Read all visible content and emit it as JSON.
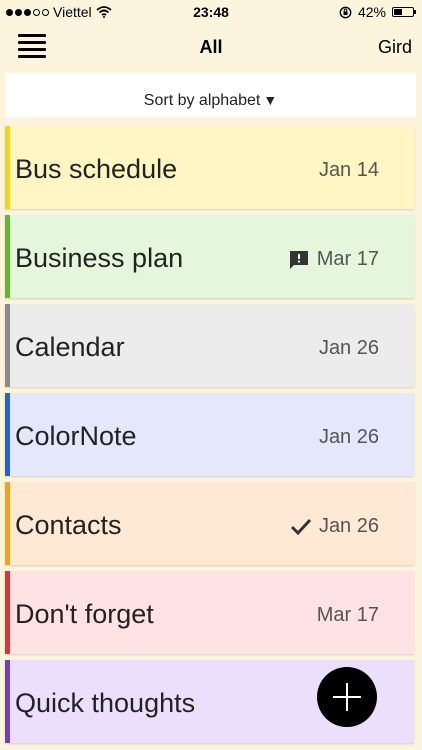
{
  "status": {
    "carrier": "Viettel",
    "time": "23:48",
    "battery": "42%",
    "battery_level": 0.42,
    "signal_bars": 3
  },
  "nav": {
    "title": "All",
    "grid_label": "Gird"
  },
  "sort": {
    "label": "Sort by alphabet",
    "arrow": "▼"
  },
  "notes": [
    {
      "title": "Bus schedule",
      "date": "Jan 14",
      "icon": "",
      "bg": "#fff6c4",
      "accent": "#f5d321"
    },
    {
      "title": "Business plan",
      "date": "Mar 17",
      "icon": "comment-icon",
      "bg": "#e4f7dc",
      "accent": "#5fb832"
    },
    {
      "title": "Calendar",
      "date": "Jan 26",
      "icon": "",
      "bg": "#ececec",
      "accent": "#8a8a8a"
    },
    {
      "title": "ColorNote",
      "date": "Jan 26",
      "icon": "",
      "bg": "#e5e8fc",
      "accent": "#2266cc"
    },
    {
      "title": "Contacts",
      "date": "Jan 26",
      "icon": "check-icon",
      "bg": "#ffe9d4",
      "accent": "#f3a21d"
    },
    {
      "title": "Don't forget",
      "date": "Mar 17",
      "icon": "",
      "bg": "#ffe3e4",
      "accent": "#d9363a"
    },
    {
      "title": "Quick thoughts",
      "date": "",
      "icon": "",
      "bg": "#ecdffb",
      "accent": "#7440b8"
    }
  ],
  "fab": {
    "icon": "plus-icon"
  }
}
